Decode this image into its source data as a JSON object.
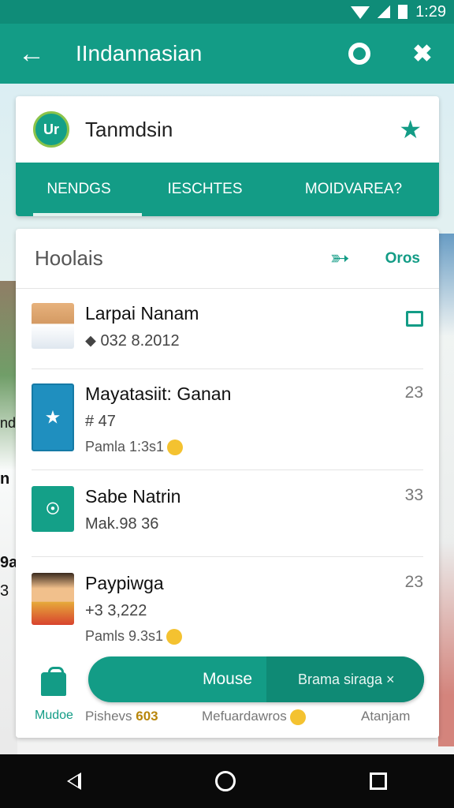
{
  "status_bar": {
    "time": "1:29"
  },
  "app_bar": {
    "title": "IIndannasian",
    "back_icon": "arrow-left-icon",
    "action1_icon": "ring-icon",
    "action2_icon": "tools-icon"
  },
  "top_card": {
    "logo_text": "Ur",
    "name": "Tanmdsin",
    "tabs": [
      "NENDGS",
      "IESCHTES",
      "MOIDVAREA?"
    ]
  },
  "list_card": {
    "header": "Hoolais",
    "options_label": "Oros",
    "items": [
      {
        "title": "Larpai Nanam",
        "line1": "⬥ 032 8.2012",
        "line2": "",
        "trailing": ""
      },
      {
        "title": "Mayatasiit: Ganan",
        "line1": "# 47",
        "line2": "Pamla 1:3s1",
        "trailing": "23"
      },
      {
        "title": "Sabe Natrin",
        "line1": "Mak.98 36",
        "line2": "",
        "trailing": "33"
      },
      {
        "title": "Paypiwga",
        "line1": "+3 3,222",
        "line2": "Pamls 9.3s1",
        "trailing": "23"
      }
    ]
  },
  "bottom": {
    "home_label": "Mudoe",
    "nav2_label": "Pishevs",
    "nav2_badge": "603",
    "nav3_label": "Mefuardawros",
    "nav4_label": "Atanjam",
    "pill_primary": "Mouse",
    "pill_secondary": "Brama siraga ×"
  },
  "edge_left_texts": [
    "nd",
    "n",
    "9a",
    "3"
  ]
}
